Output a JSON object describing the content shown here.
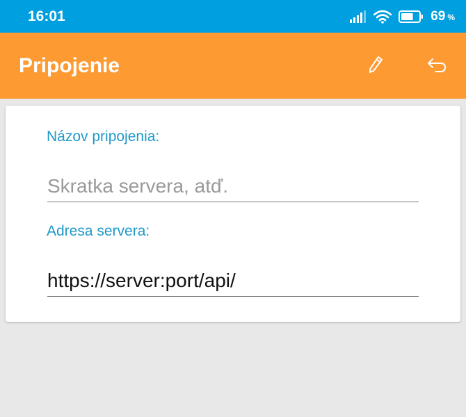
{
  "status_bar": {
    "time": "16:01",
    "battery_percent": "69",
    "battery_unit": "%",
    "battery_level": 0.69,
    "icons": [
      "signal-icon",
      "wifi-icon",
      "battery-icon"
    ]
  },
  "app_bar": {
    "title": "Pripojenie",
    "actions": [
      "edit-icon",
      "back-icon"
    ]
  },
  "form": {
    "name_label": "Názov pripojenia:",
    "name_placeholder": "Skratka servera, atď.",
    "name_value": "",
    "address_label": "Adresa servera:",
    "address_placeholder": "",
    "address_value": "https://server:port/api/"
  },
  "colors": {
    "status_bar": "#00a0e0",
    "app_bar": "#fd9a32",
    "label": "#1f9ac9",
    "background": "#e8e8e8"
  }
}
